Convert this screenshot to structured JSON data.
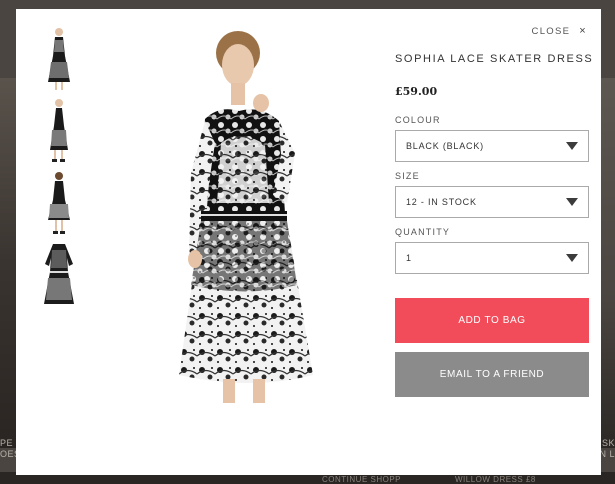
{
  "background": {
    "left_text_1": "PE",
    "left_text_2": "OES",
    "right_text_1": "SK",
    "right_text_2": "IN L",
    "bottom_text_1": "CONTINUE SHOPP",
    "bottom_text_2": "WILLOW DRESS £8"
  },
  "modal": {
    "close_label": "CLOSE",
    "close_icon": "×"
  },
  "thumbnails": [
    {
      "name": "thumbnail-front",
      "alt": "front"
    },
    {
      "name": "thumbnail-side",
      "alt": "side"
    },
    {
      "name": "thumbnail-back",
      "alt": "back"
    },
    {
      "name": "thumbnail-flat",
      "alt": "flat lay"
    }
  ],
  "product": {
    "title": "SOPHIA LACE SKATER DRESS",
    "price": "£59.00",
    "colour_label": "COLOUR",
    "colour_value": "BLACK (BLACK)",
    "size_label": "SIZE",
    "size_value": "12 - IN STOCK",
    "quantity_label": "QUANTITY",
    "quantity_value": "1",
    "add_to_bag_label": "ADD TO BAG",
    "email_label": "EMAIL TO A FRIEND"
  },
  "colors": {
    "add_to_bag": "#f24b59",
    "email_button": "#8b8b8b",
    "overlay": "#4a4541"
  }
}
